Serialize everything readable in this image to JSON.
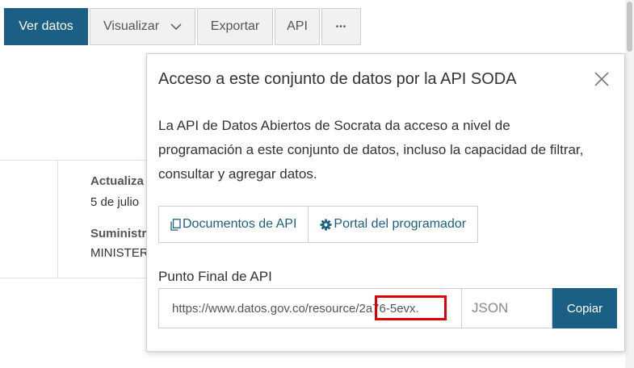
{
  "toolbar": {
    "view_data": "Ver datos",
    "visualize": "Visualizar",
    "export": "Exportar",
    "api": "API",
    "more": "•••"
  },
  "background": {
    "updated_label": "Actualiza",
    "updated_value": "5 de julio",
    "provider_label": "Suministr",
    "provider_value": "MINISTER"
  },
  "popover": {
    "title": "Acceso a este conjunto de datos por la API SODA",
    "description": "La API de Datos Abiertos de Socrata da acceso a nivel de programación a este conjunto de datos, incluso la capacidad de filtrar, consultar y agregar datos.",
    "docs_button": "Documentos de API",
    "portal_button": "Portal del programador",
    "endpoint_label": "Punto Final de API",
    "endpoint_url": "https://www.datos.gov.co/resource/2a76-5evx.",
    "format": "JSON",
    "copy_button": "Copiar"
  },
  "colors": {
    "primary": "#1b5f85",
    "highlight": "#e00000"
  },
  "icons": [
    "chevron-down-icon",
    "close-icon",
    "copy-icon",
    "gear-icon"
  ]
}
